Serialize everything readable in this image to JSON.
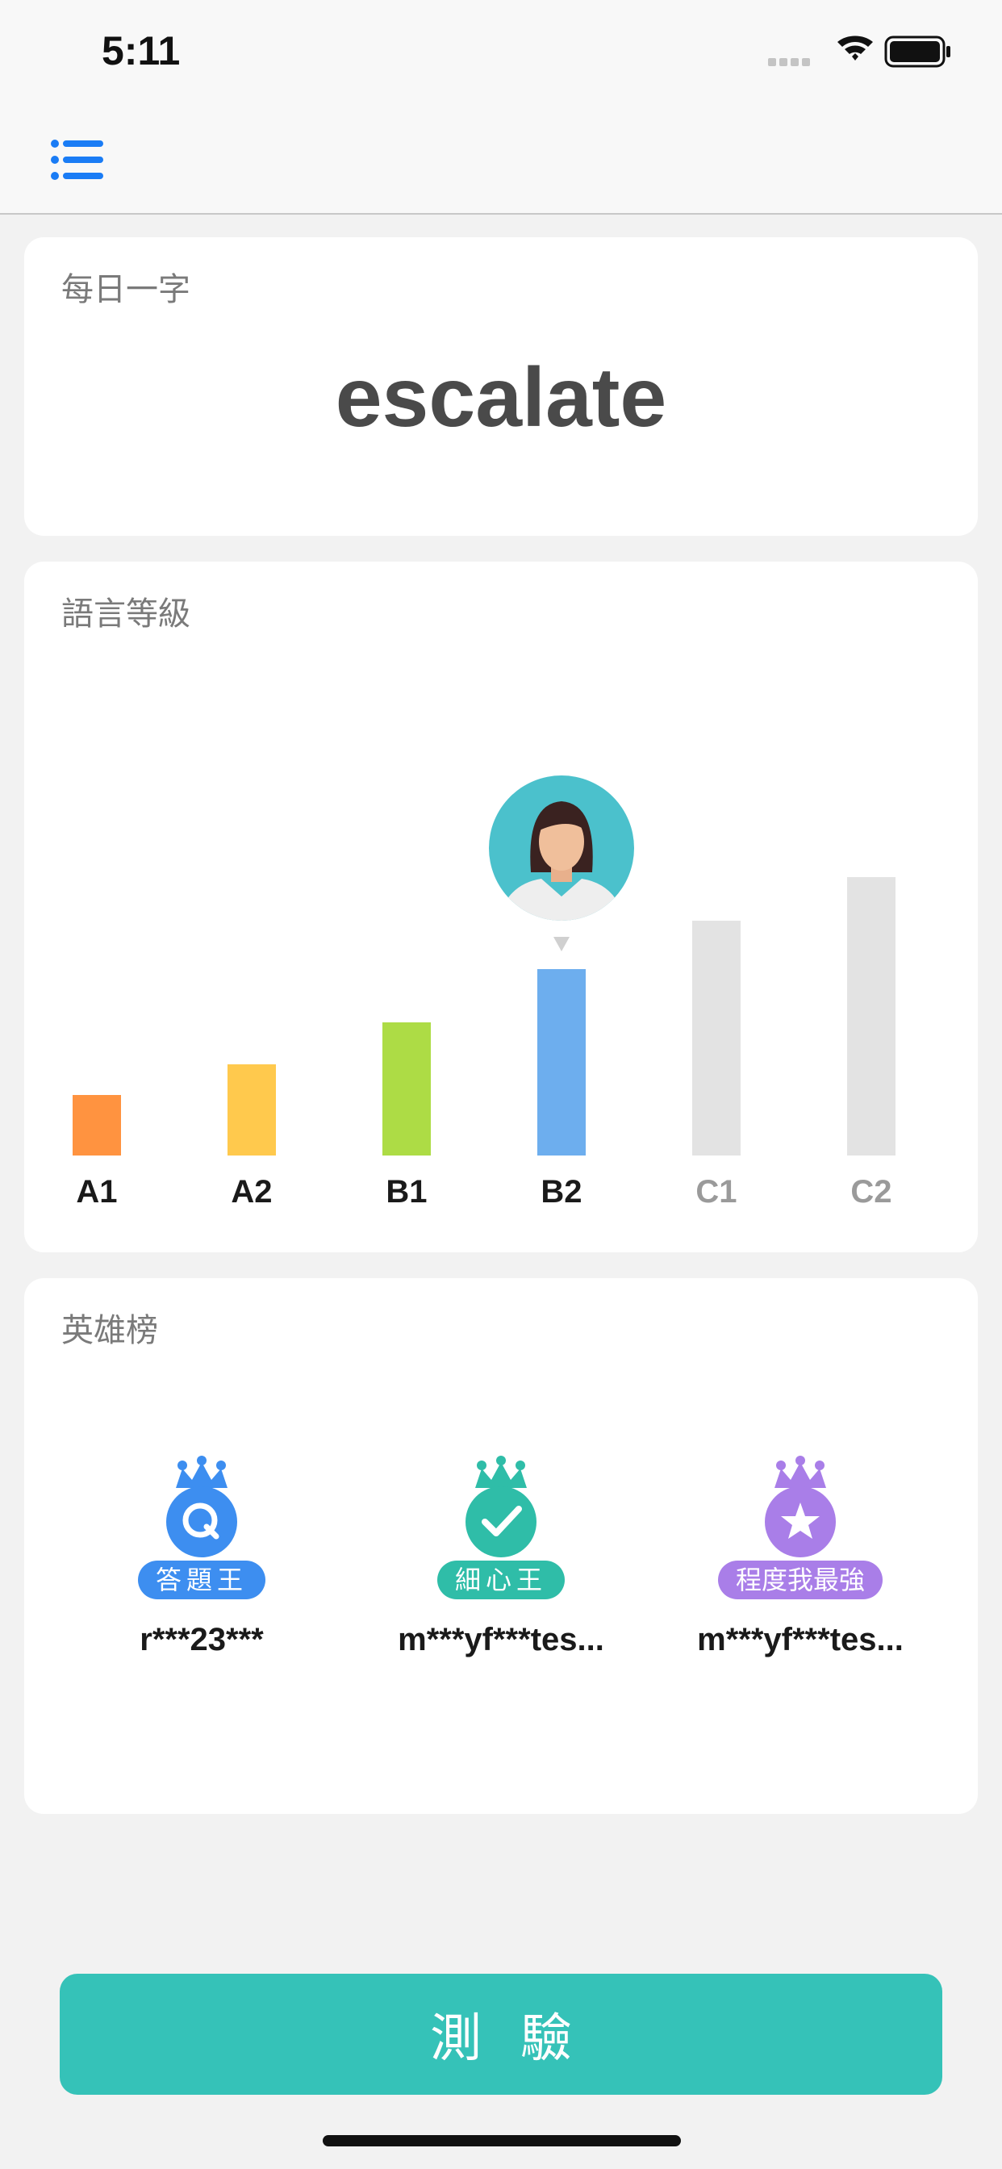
{
  "status_bar": {
    "time": "5:11"
  },
  "nav": {
    "menu_icon": "list-icon",
    "accent_color": "#1a7cf5"
  },
  "daily_word": {
    "title": "每日一字",
    "word": "escalate"
  },
  "level_chart": {
    "title": "語言等級",
    "current_level": "B2"
  },
  "chart_data": {
    "type": "bar",
    "title": "語言等級",
    "categories": [
      "A1",
      "A2",
      "B1",
      "B2",
      "C1",
      "C2"
    ],
    "values": [
      75,
      113,
      165,
      231,
      291,
      345
    ],
    "colors": [
      "#ff9340",
      "#ffc94d",
      "#addc45",
      "#6daeee",
      "#e3e3e3",
      "#e3e3e3"
    ],
    "label_colors": [
      "#1a1a1a",
      "#1a1a1a",
      "#1a1a1a",
      "#1a1a1a",
      "#9a9a9a",
      "#9a9a9a"
    ],
    "highlight": "B2",
    "xlabel": "",
    "ylabel": ""
  },
  "leaderboard": {
    "title": "英雄榜",
    "heroes": [
      {
        "tag": "答題王",
        "name": "r***23***",
        "color": "#3d8ef0",
        "icon": "q-icon"
      },
      {
        "tag": "細心王",
        "name": "m***yf***tes...",
        "color": "#2fbda8",
        "icon": "check-icon"
      },
      {
        "tag": "程度我最強",
        "name": "m***yf***tes...",
        "color": "#a97ee8",
        "icon": "star-icon"
      }
    ]
  },
  "quiz_button": {
    "label": "測驗",
    "color": "#35c2b8"
  }
}
